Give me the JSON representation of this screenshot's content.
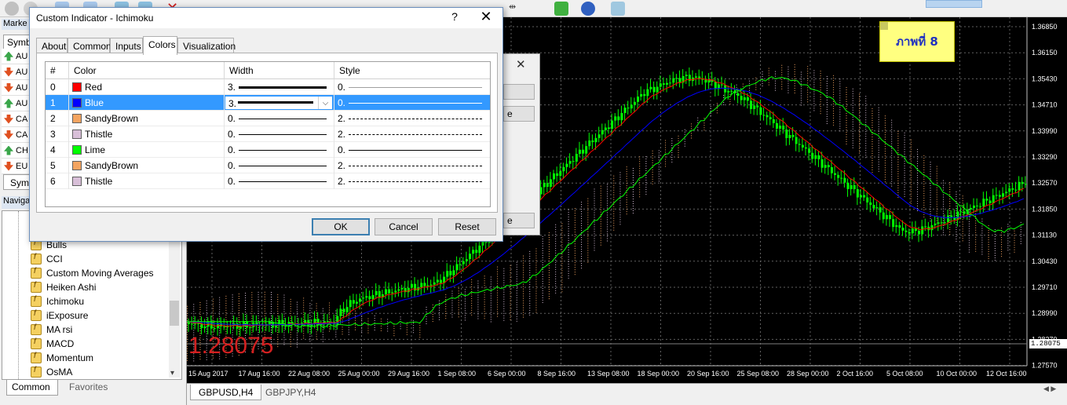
{
  "market_watch": {
    "title": "Marke",
    "tab_symbols": "Symb",
    "symbols": [
      {
        "text": "AU",
        "dir": "up"
      },
      {
        "text": "AU",
        "dir": "down"
      },
      {
        "text": "AU",
        "dir": "down"
      },
      {
        "text": "AU",
        "dir": "up"
      },
      {
        "text": "CA",
        "dir": "down"
      },
      {
        "text": "CA",
        "dir": "down"
      },
      {
        "text": "CH",
        "dir": "up"
      },
      {
        "text": "EU",
        "dir": "down"
      }
    ],
    "bottom_tab": "Sym"
  },
  "navigator": {
    "title": "Naviga",
    "items": [
      "Bulls",
      "CCI",
      "Custom Moving Averages",
      "Heiken Ashi",
      "Ichimoku",
      "iExposure",
      "MA rsi",
      "MACD",
      "Momentum",
      "OsMA"
    ],
    "tabs": [
      "Common",
      "Favorites"
    ]
  },
  "dialog": {
    "title": "Custom Indicator - Ichimoku",
    "help": "?",
    "close": "✕",
    "tabs": [
      "About",
      "Common",
      "Inputs",
      "Colors",
      "Visualization"
    ],
    "active_tab": "Colors",
    "columns": [
      "#",
      "Color",
      "Width",
      "Style"
    ],
    "rows": [
      {
        "index": "0",
        "color_name": "Red",
        "color": "#ff0000",
        "width": "3.",
        "style": "0."
      },
      {
        "index": "1",
        "color_name": "Blue",
        "color": "#0000ff",
        "width": "3.",
        "style": "0."
      },
      {
        "index": "2",
        "color_name": "SandyBrown",
        "color": "#f4a460",
        "width": "0.",
        "style": "2."
      },
      {
        "index": "3",
        "color_name": "Thistle",
        "color": "#d8bfd8",
        "width": "0.",
        "style": "2."
      },
      {
        "index": "4",
        "color_name": "Lime",
        "color": "#00ff00",
        "width": "0.",
        "style": "0."
      },
      {
        "index": "5",
        "color_name": "SandyBrown",
        "color": "#f4a460",
        "width": "0.",
        "style": "2."
      },
      {
        "index": "6",
        "color_name": "Thistle",
        "color": "#d8bfd8",
        "width": "0.",
        "style": "2."
      }
    ],
    "selected_row": 1,
    "ok_label": "OK",
    "cancel_label": "Cancel",
    "reset_label": "Reset"
  },
  "back_dialog": {
    "close": "✕",
    "btn_label": "e"
  },
  "chart": {
    "price_axis": [
      "1.36850",
      "1.36150",
      "1.35430",
      "1.34710",
      "1.33990",
      "1.33290",
      "1.32570",
      "1.31850",
      "1.31130",
      "1.30430",
      "1.29710",
      "1.28990",
      "1.28270",
      "1.27570"
    ],
    "current_price_label": "1.28075",
    "big_price": "1.28075",
    "time_axis": [
      "15 Aug 2017",
      "17 Aug 16:00",
      "22 Aug 08:00",
      "25 Aug 00:00",
      "29 Aug 16:00",
      "1 Sep 08:00",
      "6 Sep 00:00",
      "8 Sep 16:00",
      "13 Sep 08:00",
      "18 Sep 00:00",
      "20 Sep 16:00",
      "25 Sep 08:00",
      "28 Sep 00:00",
      "2 Oct 16:00",
      "5 Oct 08:00",
      "10 Oct 00:00",
      "12 Oct 16:00"
    ],
    "note_text": "ภาพที่ 8",
    "colors": {
      "candles": "#00ff00",
      "tenkan": "#ff0000",
      "kijun": "#0000ff",
      "chikou": "#00ff00",
      "cloud_a": "#f4a460",
      "cloud_b": "#d8bfd8"
    }
  },
  "chart_tabs": [
    "GBPUSD,H4",
    "GBPJPY,H4"
  ]
}
